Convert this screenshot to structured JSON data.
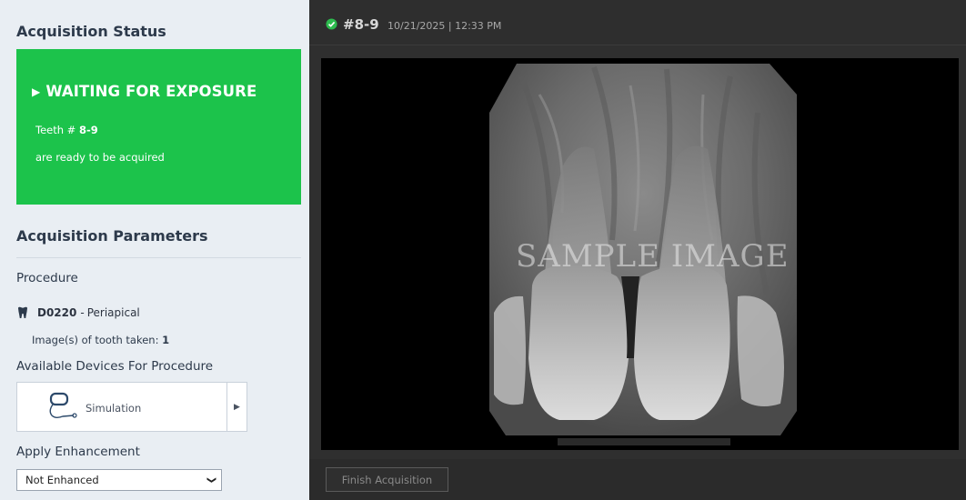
{
  "left_panel": {
    "acquisition_status_title": "Acquisition Status",
    "status": {
      "headline": "WAITING FOR EXPOSURE",
      "teeth_label": "Teeth # ",
      "teeth_value": "8-9",
      "ready_text": "are ready to be acquired",
      "color": "#1cc34b"
    },
    "acquisition_parameters_title": "Acquisition Parameters",
    "procedure_label": "Procedure",
    "procedure": {
      "code": "D0220",
      "separator": " - ",
      "name": "Periapical",
      "taken_label": "Image(s) of tooth  taken: ",
      "taken_count": "1"
    },
    "devices_label": "Available Devices For Procedure",
    "device": {
      "name": "Simulation"
    },
    "enhancement_label": "Apply Enhancement",
    "enhancement_select": {
      "selected": "Not Enhanced"
    }
  },
  "right_panel": {
    "header": {
      "title": "#8-9",
      "datetime": "10/21/2025 | 12:33 PM",
      "status_icon": "check-circle-icon",
      "status_color": "#2dbb4e"
    },
    "image": {
      "watermark": "SAMPLE IMAGE"
    },
    "footer": {
      "finish_button": "Finish Acquisition"
    }
  }
}
